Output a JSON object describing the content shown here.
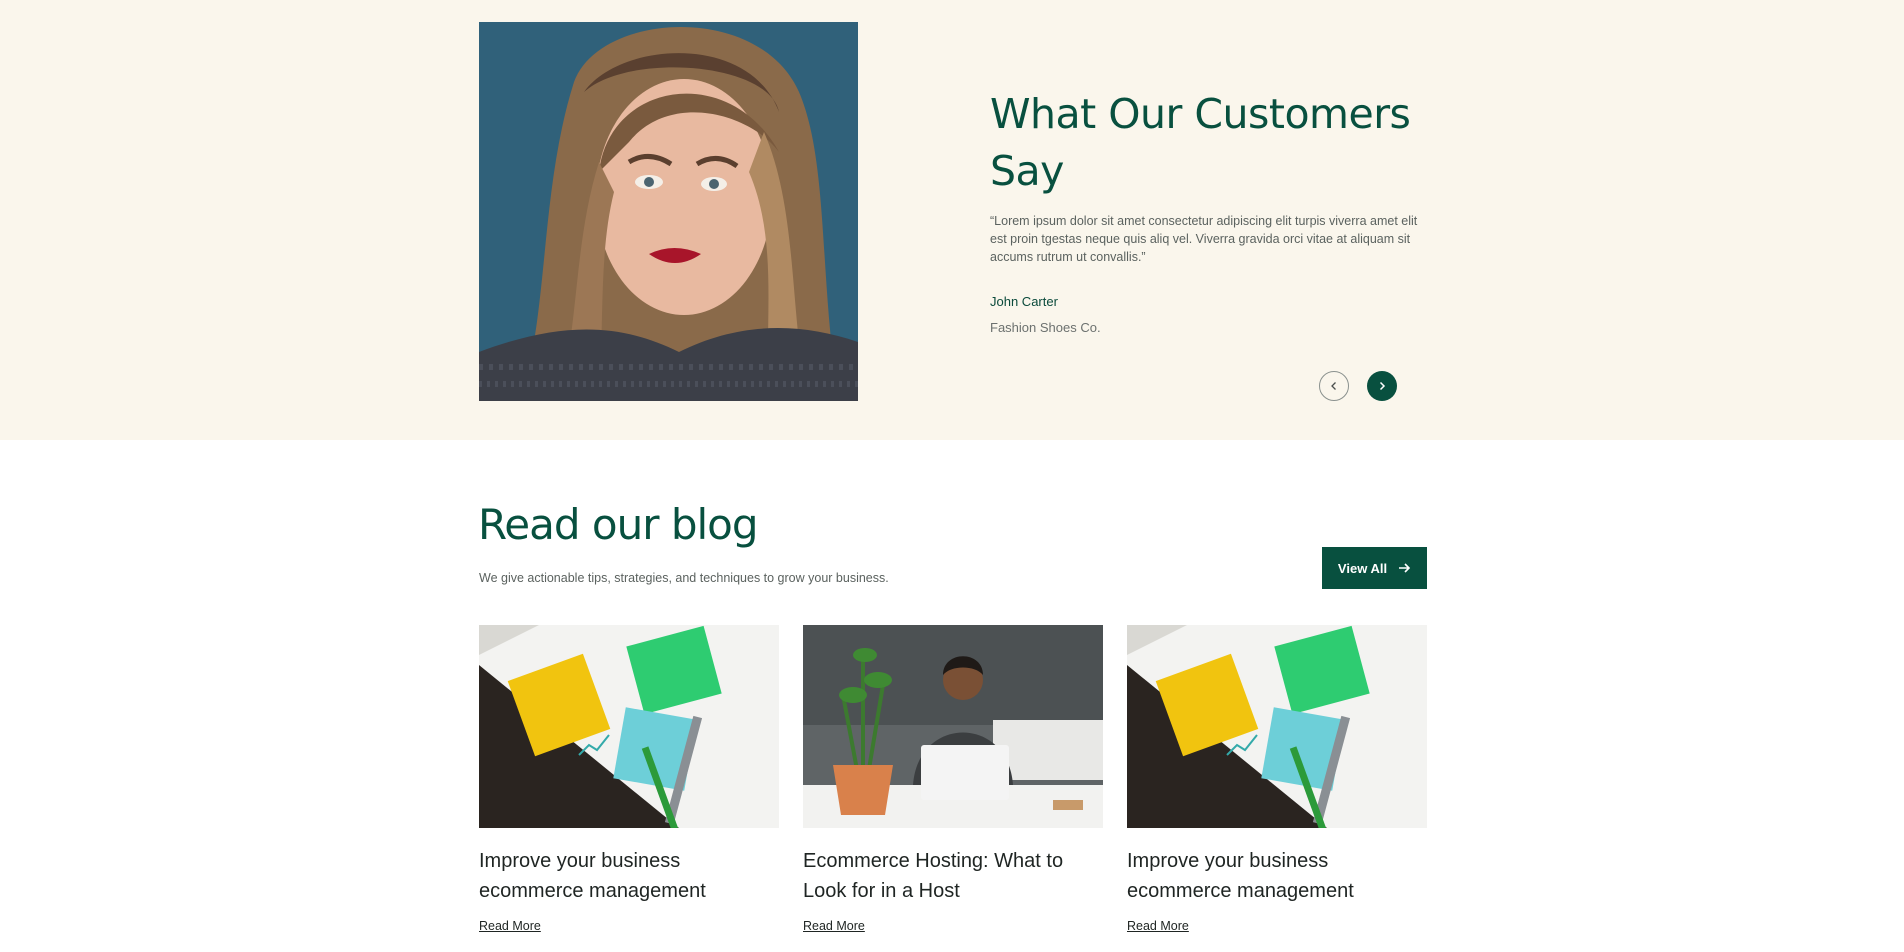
{
  "testimonial": {
    "title": "What Our Customers Say",
    "quote": "“Lorem ipsum dolor sit amet consectetur adipiscing elit turpis viverra amet elit est proin tgestas neque quis aliq vel. Viverra gravida orci vitae at aliquam sit accums rutrum ut convallis.”",
    "name": "John Carter",
    "company": "Fashion Shoes Co."
  },
  "blog": {
    "title": "Read our blog",
    "subtitle": "We give actionable tips, strategies, and techniques to grow your business.",
    "view_all_label": "View All",
    "posts": [
      {
        "title": "Improve your business ecommerce management",
        "link_label": "Read More"
      },
      {
        "title": "Ecommerce Hosting: What to Look for in a Host",
        "link_label": "Read More"
      },
      {
        "title": "Improve your business ecommerce management",
        "link_label": "Read More"
      }
    ]
  },
  "colors": {
    "brand": "#08503f",
    "section_bg": "#faf6ec"
  },
  "icons": [
    "chevron-left-icon",
    "chevron-right-icon",
    "arrow-right-icon"
  ]
}
